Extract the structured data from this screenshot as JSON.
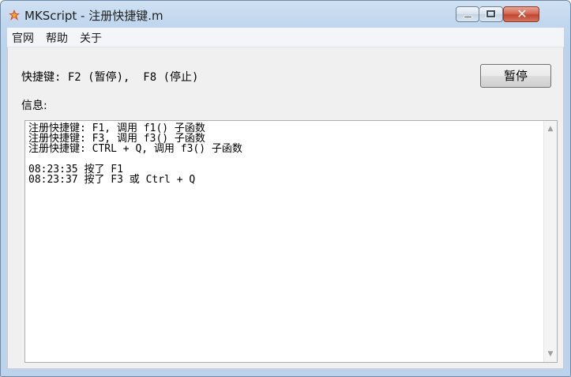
{
  "window": {
    "title": "MKScript - 注册快捷键.m",
    "close_glyph": "✕"
  },
  "menu": [
    "官网",
    "帮助",
    "关于"
  ],
  "hotkey_label": "快捷键: F2 (暂停),  F8 (停止)",
  "pause_button_label": "暂停",
  "info_label": "信息:",
  "log": {
    "registrations": [
      "注册快捷键: F1, 调用 f1() 子函数",
      "注册快捷键: F3, 调用 f3() 子函数",
      "注册快捷键: CTRL + Q, 调用 f3() 子函数"
    ],
    "events": [
      "08:23:35 按了 F1",
      "08:23:37 按了 F3 或 Ctrl + Q"
    ]
  },
  "scrollbar": {
    "up_glyph": "▲",
    "down_glyph": "▼"
  },
  "colors": {
    "titlebar": "#c1d7ee",
    "close_button": "#c2462f",
    "client_bg": "#f0f0f0"
  }
}
